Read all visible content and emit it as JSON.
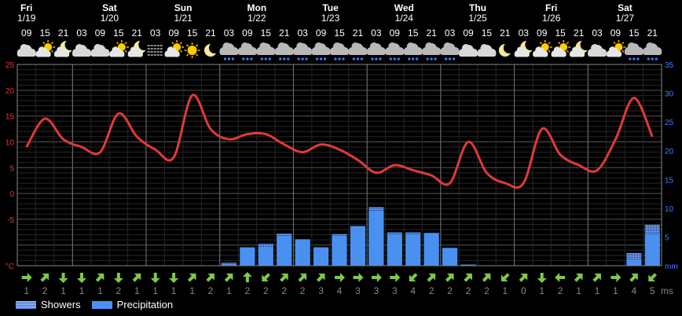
{
  "days": [
    {
      "name": "Fri",
      "date": "1/19"
    },
    {
      "name": "Sat",
      "date": "1/20"
    },
    {
      "name": "Sun",
      "date": "1/21"
    },
    {
      "name": "Mon",
      "date": "1/22"
    },
    {
      "name": "Tue",
      "date": "1/23"
    },
    {
      "name": "Wed",
      "date": "1/24"
    },
    {
      "name": "Thu",
      "date": "1/25"
    },
    {
      "name": "Fri",
      "date": "1/26"
    },
    {
      "name": "Sat",
      "date": "1/27"
    }
  ],
  "hours": [
    "09",
    "15",
    "21",
    "03",
    "09",
    "15",
    "21",
    "03",
    "09",
    "15",
    "21",
    "03",
    "09",
    "15",
    "21",
    "03",
    "09",
    "15",
    "21",
    "03",
    "09",
    "15",
    "21",
    "03",
    "09",
    "15",
    "21",
    "03",
    "09",
    "15",
    "21",
    "03",
    "09",
    "15",
    "21"
  ],
  "icons": [
    "cloudy",
    "partly-sunny",
    "partly-cloudy-night",
    "cloudy",
    "cloudy",
    "partly-sunny",
    "partly-cloudy-night",
    "fog",
    "partly-sunny",
    "sunny",
    "moon",
    "rain-cloud",
    "rain-cloud",
    "rain-cloud",
    "rain-cloud",
    "rain-cloud",
    "rain-cloud",
    "rain-cloud",
    "rain-cloud",
    "rain-cloud",
    "rain-cloud",
    "rain-cloud",
    "rain-cloud",
    "rain-cloud",
    "cloudy",
    "cloudy",
    "moon",
    "partly-cloudy-night",
    "partly-sunny",
    "partly-sunny",
    "partly-cloudy-night",
    "cloudy",
    "partly-sunny",
    "rain-cloud",
    "rain-cloud"
  ],
  "chart_data": {
    "type": "line",
    "x": [
      "Fri 1/19 09",
      "15",
      "21",
      "Sat 1/20 03",
      "09",
      "15",
      "21",
      "Sun 1/21 03",
      "09",
      "15",
      "21",
      "Mon 1/22 03",
      "09",
      "15",
      "21",
      "Tue 1/23 03",
      "09",
      "15",
      "21",
      "Wed 1/24 03",
      "09",
      "15",
      "21",
      "Thu 1/25 03",
      "09",
      "15",
      "21",
      "Fri 1/26 03",
      "09",
      "15",
      "21",
      "Sat 1/27 03",
      "09",
      "15",
      "21"
    ],
    "series": [
      {
        "axis": "left",
        "unit": "°C",
        "color": "#e03a3a",
        "values": [
          9,
          14.5,
          10.5,
          9,
          8,
          15.5,
          11,
          8.5,
          7,
          19,
          12.5,
          10.5,
          11.5,
          11.5,
          9.5,
          8,
          9.5,
          8.5,
          6.5,
          4,
          5.5,
          4.5,
          3.5,
          2,
          10,
          4,
          2,
          2,
          12.5,
          7.5,
          5.5,
          4.5,
          10.5,
          18.5,
          11
        ]
      },
      {
        "axis": "right",
        "name": "Precipitation",
        "unit": "mm",
        "color": "#4a90f0",
        "values": [
          0,
          0,
          0,
          0,
          0,
          0,
          0,
          0,
          0,
          0,
          0,
          0.2,
          3.2,
          3.2,
          5.2,
          4.6,
          3.2,
          5.2,
          6.9,
          9.6,
          5.5,
          5.5,
          5.7,
          3.1,
          0.2,
          0,
          0,
          0,
          0,
          0,
          0,
          0,
          0,
          1,
          5.5
        ]
      },
      {
        "axis": "right",
        "name": "Showers",
        "unit": "mm",
        "values": [
          0,
          0,
          0,
          0,
          0,
          0,
          0,
          0,
          0,
          0,
          0,
          0.3,
          0,
          0.6,
          0.4,
          0,
          0,
          0.3,
          0,
          0.6,
          0.3,
          0.3,
          0,
          0,
          0,
          0,
          0,
          0,
          0,
          0,
          0,
          0,
          0,
          1.2,
          1.6
        ]
      }
    ],
    "yleft": {
      "ticks": [
        25,
        20,
        15,
        10,
        5,
        0,
        -5
      ],
      "unit": "°C",
      "range": [
        -14,
        25
      ]
    },
    "yright": {
      "ticks": [
        35,
        30,
        25,
        20,
        15,
        10,
        5
      ],
      "unit": "mm",
      "range": [
        0,
        35
      ]
    },
    "grid": true
  },
  "wind": {
    "dirs": [
      "E",
      "NE",
      "S",
      "S",
      "NE",
      "S",
      "NE",
      "S",
      "S",
      "NE",
      "NE",
      "NE",
      "N",
      "SW",
      "NE",
      "NE",
      "NE",
      "E",
      "E",
      "E",
      "E",
      "SW",
      "NE",
      "NE",
      "NE",
      "NE",
      "SW",
      "NE",
      "S",
      "W",
      "NE",
      "NE",
      "E",
      "NE",
      "SW"
    ],
    "speeds": [
      "1",
      "2",
      "1",
      "1",
      "1",
      "2",
      "1",
      "1",
      "1",
      "1",
      "2",
      "1",
      "2",
      "2",
      "2",
      "2",
      "3",
      "4",
      "3",
      "3",
      "3",
      "4",
      "2",
      "2",
      "2",
      "2",
      "1",
      "0",
      "1",
      "2",
      "1",
      "1",
      "1",
      "4",
      "5"
    ],
    "unit": "ms"
  },
  "legend": {
    "showers": "Showers",
    "precip": "Precipitation"
  }
}
